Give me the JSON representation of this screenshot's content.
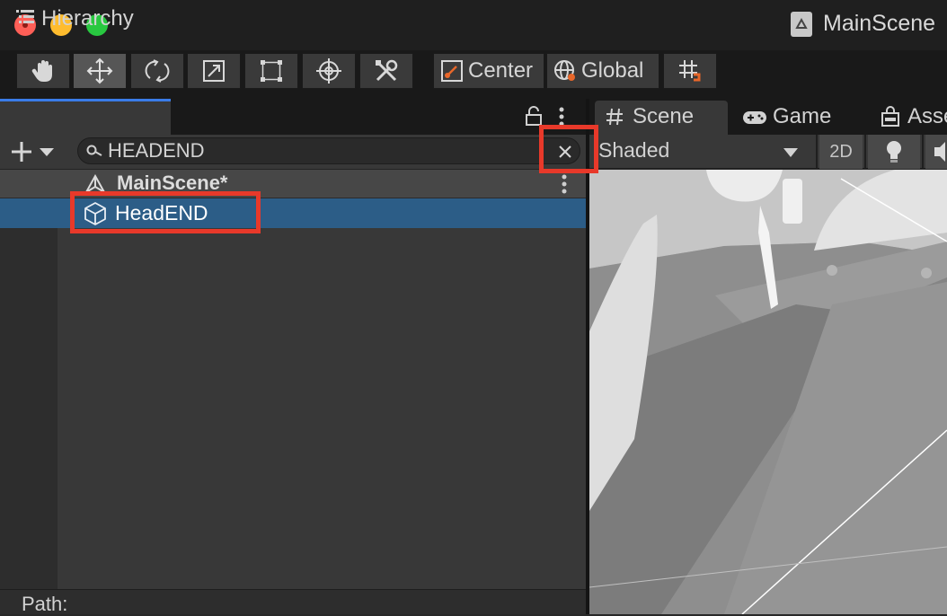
{
  "window": {
    "title": "MainScene",
    "controls": [
      "close",
      "minimize",
      "maximize"
    ]
  },
  "toolbar": {
    "tools": [
      {
        "name": "hand-tool",
        "icon": "hand-icon"
      },
      {
        "name": "move-tool",
        "icon": "move-arrows-icon",
        "active": true
      },
      {
        "name": "rotate-tool",
        "icon": "rotate-icon"
      },
      {
        "name": "scale-tool",
        "icon": "scale-icon"
      },
      {
        "name": "rect-tool",
        "icon": "rect-transform-icon"
      },
      {
        "name": "transform-tool",
        "icon": "transform-icon"
      },
      {
        "name": "custom-tool",
        "icon": "tools-icon"
      }
    ],
    "pivot_mode": "Center",
    "pivot_rotation": "Global",
    "grid_snap_icon": "grid-snap-icon"
  },
  "hierarchy": {
    "tab_label": "Hierarchy",
    "search_value": "HEADEND",
    "scene": {
      "label": "MainScene*"
    },
    "items": [
      {
        "label": "HeadEND",
        "selected": true,
        "icon": "gameobject-cube-icon"
      }
    ],
    "path_label": "Path:"
  },
  "scene_view": {
    "tabs": [
      {
        "label": "Scene",
        "icon": "grid-hash-icon",
        "active": true
      },
      {
        "label": "Game",
        "icon": "gamepad-icon"
      },
      {
        "label": "Asse",
        "icon": "asset-store-icon"
      }
    ],
    "shading_mode": "Shaded",
    "mode_2d_label": "2D"
  },
  "colors": {
    "selection": "#2c5d87",
    "tab_accent": "#3a7ce8",
    "annotation": "#e8392a",
    "panel_bg": "#383838"
  }
}
